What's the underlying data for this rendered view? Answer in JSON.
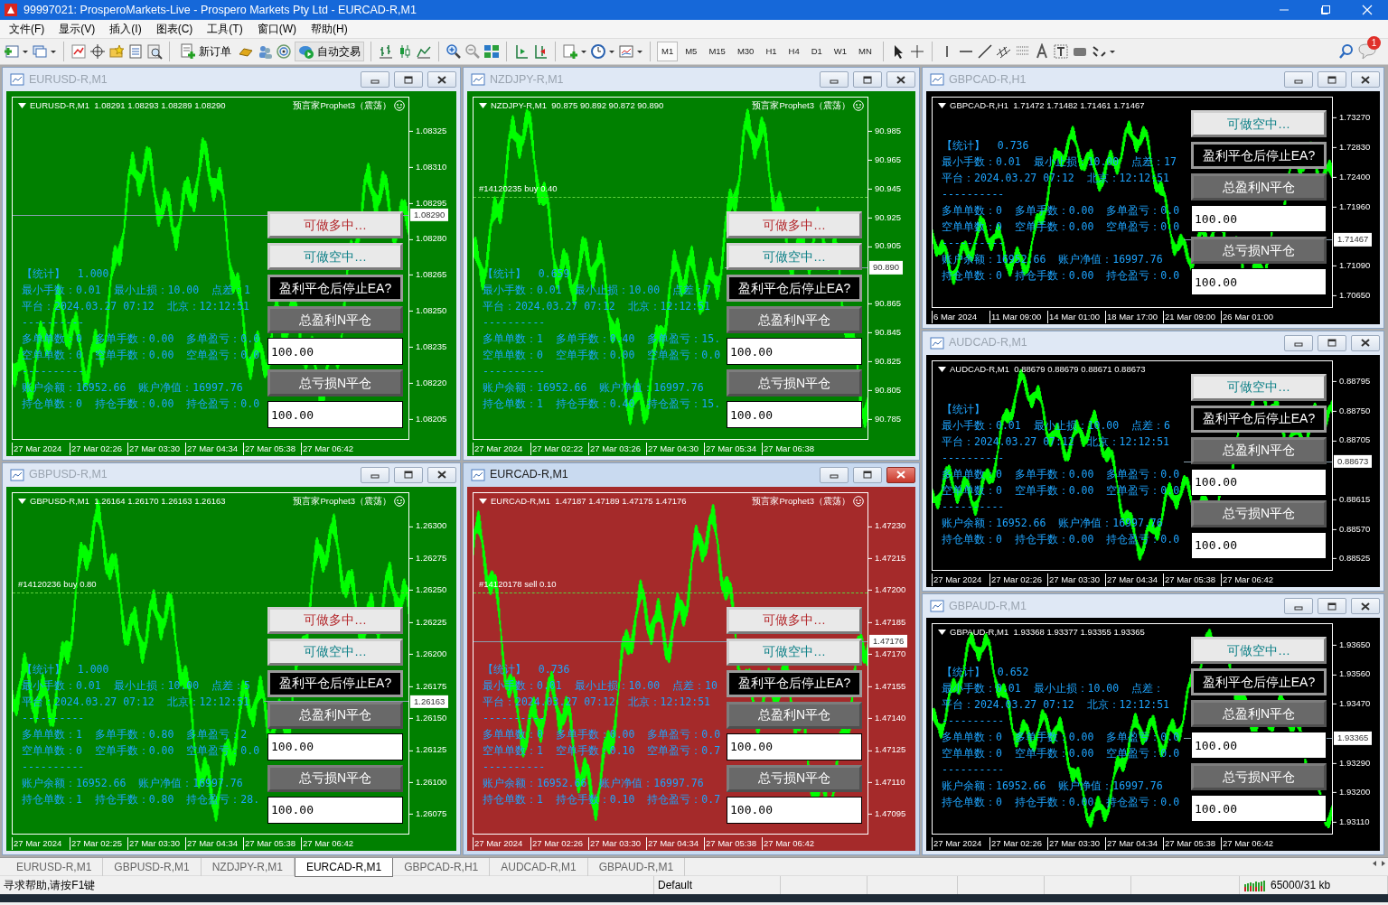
{
  "window": {
    "title": "99997021: ProsperoMarkets-Live - Prospero Markets Pty Ltd - EURCAD-R,M1"
  },
  "menu": [
    "文件(F)",
    "显示(V)",
    "插入(I)",
    "图表(C)",
    "工具(T)",
    "窗口(W)",
    "帮助(H)"
  ],
  "toolbar": {
    "new_order": "新订单",
    "auto_trading": "自动交易",
    "notifications": "1",
    "timeframes": [
      {
        "label": "M1",
        "selected": true
      },
      {
        "label": "M5",
        "selected": false
      },
      {
        "label": "M15",
        "selected": false
      },
      {
        "label": "M30",
        "selected": false
      },
      {
        "label": "H1",
        "selected": false
      },
      {
        "label": "H4",
        "selected": false
      },
      {
        "label": "D1",
        "selected": false
      },
      {
        "label": "W1",
        "selected": false
      },
      {
        "label": "MN",
        "selected": false
      }
    ]
  },
  "columns": [
    [
      {
        "title": "EURUSD-R,M1",
        "active": false,
        "color": "#008000",
        "symbol_line": "EURUSD-R,M1  1.08291 1.08293 1.08289 1.08290",
        "ea_label": "预言家Prophet3（震荡）",
        "price_ticks": [
          "1.08325",
          "1.08310",
          "1.08295",
          "1.08280",
          "1.08265",
          "1.08250",
          "1.08235",
          "1.08220",
          "1.08205"
        ],
        "current_price": "1.08290",
        "time_labels": [
          "27 Mar 2024",
          "27 Mar 02:26",
          "27 Mar 03:30",
          "27 Mar 04:34",
          "27 Mar 05:38",
          "27 Mar 06:42"
        ],
        "stats": [
          "【统计】  1.000",
          "最小手数：0.01  最小止损：10.00  点差：1",
          "平台：2024.03.27 07:12  北京：12:12:51",
          "----------",
          "多单单数：0  多单手数：0.00  多单盈亏：0.0",
          "空单单数：0  空单手数：0.00  空单盈亏：0.0",
          "----------",
          "账户余额：16952.66  账户净值：16997.76",
          "持仓单数：0  持仓手数：0.00  持仓盈亏：0.0"
        ],
        "controls": [
          {
            "kind": "long",
            "label": "可做多中…"
          },
          {
            "kind": "short",
            "label": "可做空中…"
          },
          {
            "kind": "stop",
            "label": "盈利平仓后停止EA?"
          },
          {
            "kind": "close",
            "label": "总盈利N平仓"
          },
          {
            "kind": "input",
            "value": "100.00"
          },
          {
            "kind": "close",
            "label": "总亏损N平仓"
          },
          {
            "kind": "input",
            "value": "100.00"
          }
        ]
      },
      {
        "title": "GBPUSD-R,M1",
        "active": false,
        "color": "#008000",
        "symbol_line": "GBPUSD-R,M1  1.26164 1.26170 1.26163 1.26163",
        "ea_label": "预言家Prophet3（震荡）",
        "trade": "#14120236 buy 0.80",
        "price_ticks": [
          "1.26300",
          "1.26275",
          "1.26250",
          "1.26225",
          "1.26200",
          "1.26175",
          "1.26150",
          "1.26125",
          "1.26100",
          "1.26075"
        ],
        "current_price": "1.26163",
        "time_labels": [
          "27 Mar 2024",
          "27 Mar 02:25",
          "27 Mar 03:30",
          "27 Mar 04:34",
          "27 Mar 05:38",
          "27 Mar 06:42"
        ],
        "stats": [
          "【统计】  1.000",
          "最小手数：0.01  最小止损：10.00  点差：5",
          "平台：2024.03.27 07:12  北京：12:12:51",
          "----------",
          "多单单数：1  多单手数：0.80  多单盈亏：2",
          "空单单数：0  空单手数：0.00  空单盈亏：0.0",
          "----------",
          "账户余额：16952.66  账户净值：16997.76",
          "持仓单数：1  持仓手数：0.80  持仓盈亏：28."
        ],
        "controls": [
          {
            "kind": "long",
            "label": "可做多中…"
          },
          {
            "kind": "short",
            "label": "可做空中…"
          },
          {
            "kind": "stop",
            "label": "盈利平仓后停止EA?"
          },
          {
            "kind": "close",
            "label": "总盈利N平仓"
          },
          {
            "kind": "input",
            "value": "100.00"
          },
          {
            "kind": "close",
            "label": "总亏损N平仓"
          },
          {
            "kind": "input",
            "value": "100.00"
          }
        ]
      }
    ],
    [
      {
        "title": "NZDJPY-R,M1",
        "active": false,
        "color": "#008000",
        "symbol_line": "NZDJPY-R,M1  90.875 90.892 90.872 90.890",
        "ea_label": "预言家Prophet3（震荡）",
        "trade": "#14120235 buy 0.40",
        "price_ticks": [
          "90.985",
          "90.965",
          "90.945",
          "90.925",
          "90.905",
          "90.865",
          "90.845",
          "90.825",
          "90.805",
          "90.785"
        ],
        "current_price": "90.890",
        "time_labels": [
          "27 Mar 2024",
          "27 Mar 02:22",
          "27 Mar 03:26",
          "27 Mar 04:30",
          "27 Mar 05:34",
          "27 Mar 06:38"
        ],
        "stats": [
          "【统计】  0.659",
          "最小手数：0.01  最小止损：10.00  点差：7",
          "平台：2024.03.27 07:12  北京：12:12:51",
          "----------",
          "多单单数：1  多单手数：0.40  多单盈亏：15.",
          "空单单数：0  空单手数：0.00  空单盈亏：0.0",
          "----------",
          "账户余额：16952.66  账户净值：16997.76",
          "持仓单数：1  持仓手数：0.40  持仓盈亏：15."
        ],
        "controls": [
          {
            "kind": "long",
            "label": "可做多中…"
          },
          {
            "kind": "short",
            "label": "可做空中…"
          },
          {
            "kind": "stop",
            "label": "盈利平仓后停止EA?"
          },
          {
            "kind": "close",
            "label": "总盈利N平仓"
          },
          {
            "kind": "input",
            "value": "100.00"
          },
          {
            "kind": "close",
            "label": "总亏损N平仓"
          },
          {
            "kind": "input",
            "value": "100.00"
          }
        ]
      },
      {
        "title": "EURCAD-R,M1",
        "active": true,
        "color": "#a52a2a",
        "symbol_line": "EURCAD-R,M1  1.47187 1.47189 1.47175 1.47176",
        "ea_label": "预言家Prophet3（震荡）",
        "trade": "#14120178 sell 0.10",
        "price_ticks": [
          "1.47230",
          "1.47215",
          "1.47200",
          "1.47185",
          "1.47170",
          "1.47155",
          "1.47140",
          "1.47125",
          "1.47110",
          "1.47095"
        ],
        "current_price": "1.47176",
        "time_labels": [
          "27 Mar 2024",
          "27 Mar 02:26",
          "27 Mar 03:30",
          "27 Mar 04:34",
          "27 Mar 05:38",
          "27 Mar 06:42"
        ],
        "stats": [
          "【统计】  0.736",
          "最小手数：0.01  最小止损：10.00  点差：10",
          "平台：2024.03.27 07:12  北京：12:12:51",
          "----------",
          "多单单数：0  多单手数：0.00  多单盈亏：0.0",
          "空单单数：1  空单手数：0.10  空单盈亏：0.7",
          "----------",
          "账户余额：16952.66  账户净值：16997.76",
          "持仓单数：1  持仓手数：0.10  持仓盈亏：0.7"
        ],
        "controls": [
          {
            "kind": "long",
            "label": "可做多中…"
          },
          {
            "kind": "short",
            "label": "可做空中…"
          },
          {
            "kind": "stop",
            "label": "盈利平仓后停止EA?"
          },
          {
            "kind": "close",
            "label": "总盈利N平仓"
          },
          {
            "kind": "input",
            "value": "100.00"
          },
          {
            "kind": "close",
            "label": "总亏损N平仓"
          },
          {
            "kind": "input",
            "value": "100.00"
          }
        ]
      }
    ],
    [
      {
        "title": "GBPCAD-R,H1",
        "active": false,
        "color": "#000000",
        "symbol_line": "GBPCAD-R,H1  1.71472 1.71482 1.71461 1.71467",
        "price_ticks": [
          "1.73270",
          "1.72830",
          "1.72400",
          "1.71960",
          "1.71090",
          "1.70650"
        ],
        "current_price": "1.71467",
        "time_labels": [
          "6 Mar 2024",
          "11 Mar 09:00",
          "14 Mar 01:00",
          "18 Mar 17:00",
          "21 Mar 09:00",
          "26 Mar 01:00"
        ],
        "stats": [
          "【统计】  0.736",
          "最小手数：0.01  最小止损：10.00  点差：17",
          "平台：2024.03.27 07:12  北京：12:12:51",
          "----------",
          "多单单数：0  多单手数：0.00  多单盈亏：0.0",
          "空单单数：0  空单手数：0.00  空单盈亏：0.0",
          "----------",
          "账户余额：16952.66  账户净值：16997.76",
          "持仓单数：0  持仓手数：0.00  持仓盈亏：0.0"
        ],
        "controls": [
          {
            "kind": "short",
            "label": "可做空中…"
          },
          {
            "kind": "stop",
            "label": "盈利平仓后停止EA?"
          },
          {
            "kind": "close",
            "label": "总盈利N平仓"
          },
          {
            "kind": "input",
            "value": "100.00"
          },
          {
            "kind": "close",
            "label": "总亏损N平仓"
          },
          {
            "kind": "input",
            "value": "100.00"
          }
        ]
      },
      {
        "title": "AUDCAD-R,M1",
        "active": false,
        "color": "#000000",
        "symbol_line": "AUDCAD-R,M1  0.88679 0.88679 0.88671 0.88673",
        "price_ticks": [
          "0.88795",
          "0.88750",
          "0.88705",
          "0.88615",
          "0.88570",
          "0.88525"
        ],
        "current_price": "0.88673",
        "time_labels": [
          "27 Mar 2024",
          "27 Mar 02:26",
          "27 Mar 03:30",
          "27 Mar 04:34",
          "27 Mar 05:38",
          "27 Mar 06:42"
        ],
        "stats": [
          "【统计】",
          "最小手数：0.01  最小止损：10.00  点差：6",
          "平台：2024.03.27 07:12  北京：12:12:51",
          "----------",
          "多单单数：0  多单手数：0.00  多单盈亏：0.0",
          "空单单数：0  空单手数：0.00  空单盈亏：0.0",
          "----------",
          "账户余额：16952.66  账户净值：16997.76",
          "持仓单数：0  持仓手数：0.00  持仓盈亏：0.0"
        ],
        "controls": [
          {
            "kind": "short",
            "label": "可做空中…"
          },
          {
            "kind": "stop",
            "label": "盈利平仓后停止EA?"
          },
          {
            "kind": "close",
            "label": "总盈利N平仓"
          },
          {
            "kind": "input",
            "value": "100.00"
          },
          {
            "kind": "close",
            "label": "总亏损N平仓"
          },
          {
            "kind": "input",
            "value": "100.00"
          }
        ]
      },
      {
        "title": "GBPAUD-R,M1",
        "active": false,
        "color": "#000000",
        "symbol_line": "GBPAUD-R,M1  1.93368 1.93377 1.93355 1.93365",
        "price_ticks": [
          "1.93650",
          "1.93560",
          "1.93470",
          "1.93290",
          "1.93200",
          "1.93110"
        ],
        "current_price": "1.93365",
        "time_labels": [
          "27 Mar 2024",
          "27 Mar 02:26",
          "27 Mar 03:30",
          "27 Mar 04:34",
          "27 Mar 05:38",
          "27 Mar 06:42"
        ],
        "stats": [
          "【统计】  0.652",
          "最小手数：0.01  最小止损：10.00  点差：",
          "平台：2024.03.27 07:12  北京：12:12:51",
          "----------",
          "多单单数：0  多单手数：0.00  多单盈亏：0.0",
          "空单单数：0  空单手数：0.00  空单盈亏：0.0",
          "----------",
          "账户余额：16952.66  账户净值：16997.76",
          "持仓单数：0  持仓手数：0.00  持仓盈亏：0.0"
        ],
        "controls": [
          {
            "kind": "short",
            "label": "可做空中…"
          },
          {
            "kind": "stop",
            "label": "盈利平仓后停止EA?"
          },
          {
            "kind": "close",
            "label": "总盈利N平仓"
          },
          {
            "kind": "input",
            "value": "100.00"
          },
          {
            "kind": "close",
            "label": "总亏损N平仓"
          },
          {
            "kind": "input",
            "value": "100.00"
          }
        ]
      }
    ]
  ],
  "tabs": [
    {
      "label": "EURUSD-R,M1",
      "selected": false
    },
    {
      "label": "GBPUSD-R,M1",
      "selected": false
    },
    {
      "label": "NZDJPY-R,M1",
      "selected": false
    },
    {
      "label": "EURCAD-R,M1",
      "selected": true
    },
    {
      "label": "GBPCAD-R,H1",
      "selected": false
    },
    {
      "label": "AUDCAD-R,M1",
      "selected": false
    },
    {
      "label": "GBPAUD-R,M1",
      "selected": false
    }
  ],
  "status_bar": {
    "help": "寻求帮助,请按F1键",
    "profile": "Default",
    "traffic": "65000/31 kb"
  }
}
